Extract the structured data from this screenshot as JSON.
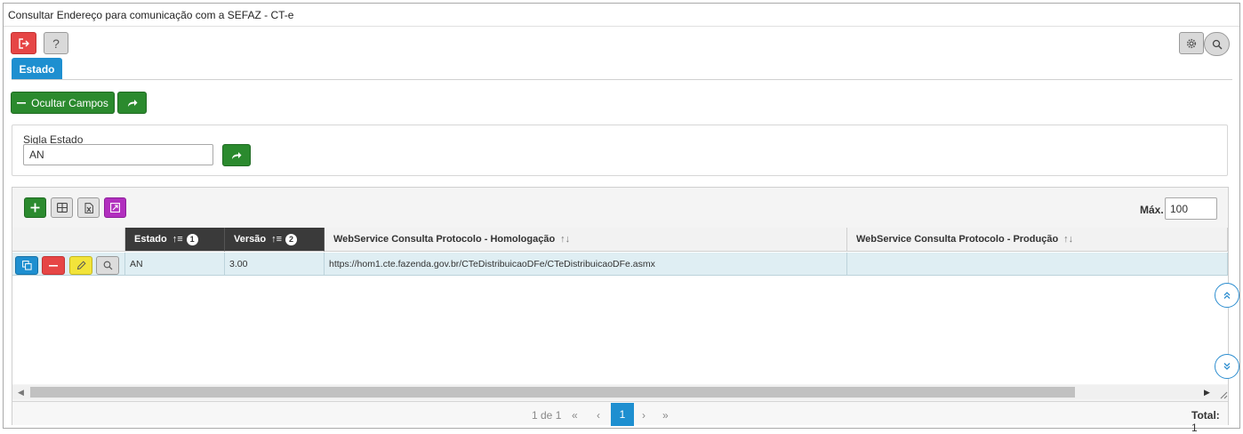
{
  "window": {
    "title": "Consultar Endereço para comunicação com a SEFAZ - CT-e"
  },
  "toolbar": {
    "help_label": "?"
  },
  "tabs": [
    {
      "label": "Estado",
      "active": true
    }
  ],
  "actions": {
    "hide_fields_label": "Ocultar Campos"
  },
  "filter": {
    "sigla_label": "Sigla Estado",
    "sigla_value": "AN"
  },
  "grid": {
    "max_label": "Máx.",
    "max_value": "100",
    "columns": [
      {
        "label": "Estado",
        "sort_order": "1"
      },
      {
        "label": "Versão",
        "sort_order": "2"
      },
      {
        "label": "WebService Consulta Protocolo - Homologação"
      },
      {
        "label": "WebService Consulta Protocolo - Produção"
      }
    ],
    "rows": [
      {
        "estado": "AN",
        "versao": "3.00",
        "homologacao": "https://hom1.cte.fazenda.gov.br/CTeDistribuicaoDFe/CTeDistribuicaoDFe.asmx",
        "producao": ""
      }
    ]
  },
  "pager": {
    "info": "1 de 1",
    "first": "«",
    "prev": "‹",
    "current_page": "1",
    "next": "›",
    "last": "»",
    "total_label": "Total:",
    "total_value": "1"
  },
  "colors": {
    "accent_blue": "#1e8fd0",
    "green": "#2b8a2e",
    "red": "#e64646",
    "yellow": "#f2e43a",
    "purple": "#b12fbe",
    "row_highlight": "#dfeef3"
  }
}
